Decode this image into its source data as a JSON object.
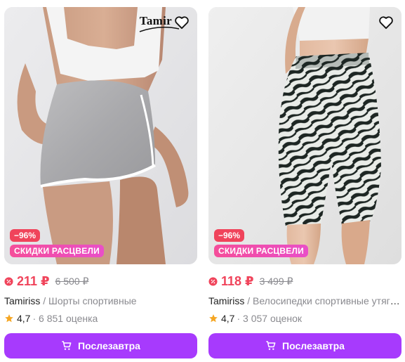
{
  "products": [
    {
      "brand_logo_text": "Tamir",
      "discount_badge": "−96%",
      "promo_badge": "СКИДКИ РАСЦВЕЛИ",
      "price": "211 ₽",
      "old_price": "6 500 ₽",
      "brand": "Tamiriss",
      "separator": " / ",
      "name": "Шорты спортивные",
      "rating": "4,7",
      "reviews": "· 6 851 оценка",
      "button_label": "Послезавтра",
      "image": "gray-dolphin-shorts-photo"
    },
    {
      "discount_badge": "−96%",
      "promo_badge": "СКИДКИ РАСЦВЕЛИ",
      "price": "118 ₽",
      "old_price": "3 499 ₽",
      "brand": "Tamiriss",
      "separator": " / ",
      "name": "Велосипедки спортивные утягивающие",
      "rating": "4,7",
      "reviews": "· 3 057 оценок",
      "button_label": "Послезавтра",
      "image": "zebra-bike-shorts-photo"
    }
  ],
  "icons": {
    "favorite": "heart-outline-icon",
    "sale": "sale-percent-icon",
    "rating": "star-icon",
    "button": "cart-icon"
  },
  "colors": {
    "price": "#f0445b",
    "button": "#a73afd",
    "promo_badge": "#f54e9a",
    "star": "#f5a623"
  }
}
